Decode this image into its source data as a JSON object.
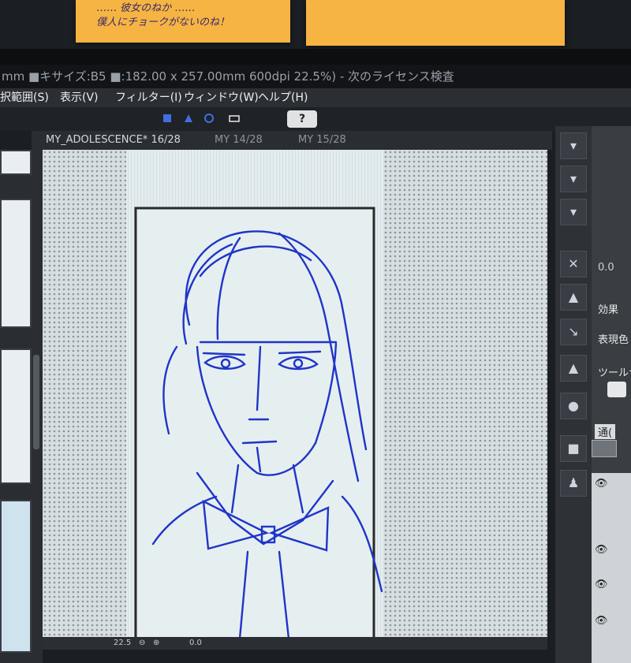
{
  "sticky_notes": {
    "left_note_text": "…… 彼女のねか ……\n僕人にチョークがないのね！",
    "right_note_text": ""
  },
  "title_bar": {
    "text": "mm ■キサイズ:B5 ■:182.00 x 257.00mm 600dpi 22.5%) - 次のライセンス検査"
  },
  "menu": {
    "items": [
      "択範囲(S)",
      "表示(V)",
      "フィルター(I)",
      "ウィンドウ(W)",
      "ヘルプ(H)"
    ]
  },
  "tabs": [
    {
      "label": "MY_ADOLESCENCE* 16/28"
    },
    {
      "label": "MY  14/28"
    },
    {
      "label": "MY  15/28"
    }
  ],
  "status_bar": {
    "zoom": "22.5",
    "angle": "0.0"
  },
  "right_panel": {
    "value": "0.0",
    "effect_label": "効果",
    "color_label": "表現色",
    "tool_label": "ツールナ",
    "blend_label": "通("
  },
  "colors": {
    "accent_ink": "#1f35c8",
    "sticky": "#f6b443"
  }
}
